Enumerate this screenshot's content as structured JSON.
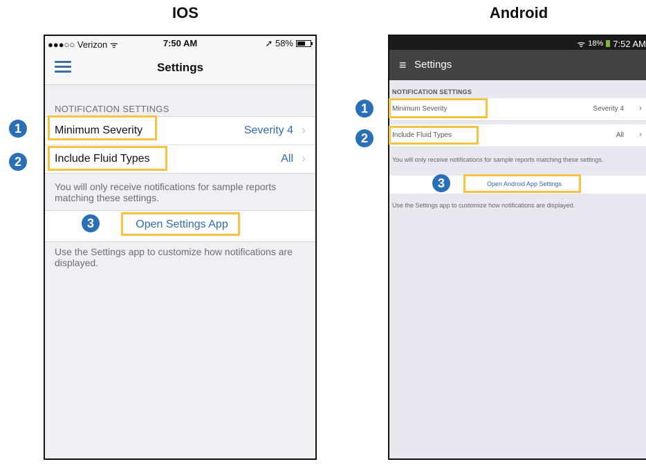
{
  "headings": {
    "ios": "IOS",
    "android": "Android"
  },
  "ios": {
    "status": {
      "carrier": "●●●○○ Verizon ᯤ",
      "time": "7:50 AM",
      "battery_text": "➚ 58%"
    },
    "nav_title": "Settings",
    "section_header": "NOTIFICATION SETTINGS",
    "rows": [
      {
        "label": "Minimum Severity",
        "value": "Severity 4",
        "chevron": "›"
      },
      {
        "label": "Include Fluid Types",
        "value": "All",
        "chevron": "›"
      }
    ],
    "footer1": "You will only receive notifications for sample reports matching these settings.",
    "button_label": "Open Settings App",
    "footer2": "Use the Settings app to customize how notifications are displayed."
  },
  "android": {
    "status": {
      "signal": "ᯤ",
      "battery_pct": "18%",
      "time": "7:52 AM"
    },
    "toolbar_menu": "≡",
    "toolbar_title": "Settings",
    "section_header": "NOTIFICATION SETTINGS",
    "rows": [
      {
        "label": "Minimum Severity",
        "value": "Severity 4",
        "chevron": "›"
      },
      {
        "label": "Include Fluid Types",
        "value": "All",
        "chevron": "›"
      }
    ],
    "footer1": "You will only receive notifications for sample reports matching these settings.",
    "button_label": "Open Android App Settings",
    "footer2": "Use the Settings app to customize how notifications are displayed."
  },
  "badges": {
    "one": "1",
    "two": "2",
    "three": "3"
  },
  "colors": {
    "highlight": "#f5c242",
    "badge": "#2b6fb7",
    "ios_accent": "#2f6bb1",
    "android_toolbar": "#424242"
  }
}
